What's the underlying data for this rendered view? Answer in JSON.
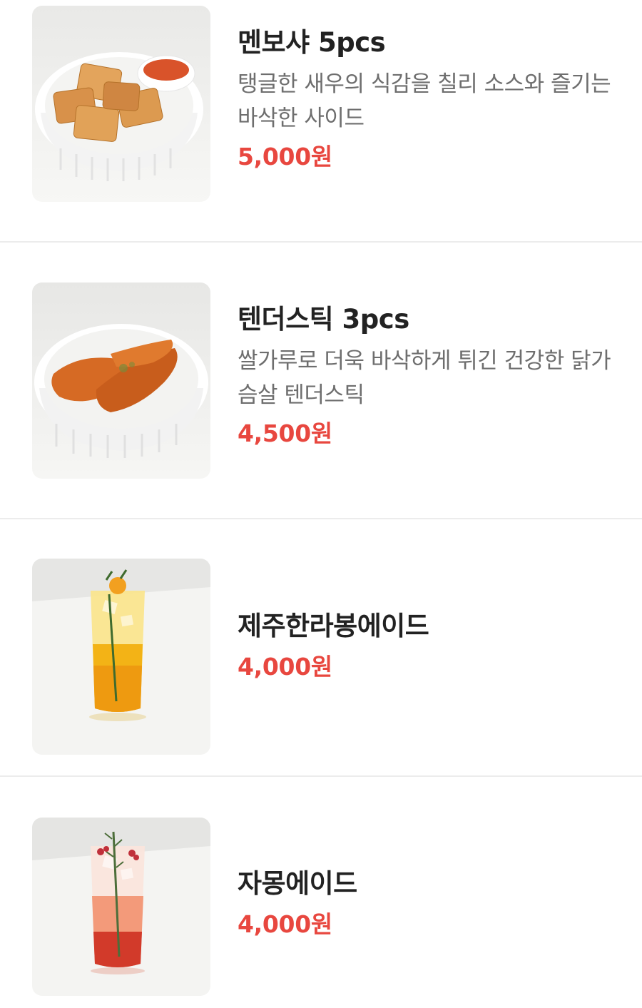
{
  "menu": {
    "items": [
      {
        "name": "멘보샤 5pcs",
        "description": "탱글한 새우의 식감을 칠리 소스와 즐기는 바삭한 사이드",
        "price": "5,000원",
        "image_icon": "menbosha-photo"
      },
      {
        "name": "텐더스틱 3pcs",
        "description": "쌀가루로 더욱 바삭하게 튀긴 건강한 닭가슴살 텐더스틱",
        "price": "4,500원",
        "image_icon": "tender-stick-photo"
      },
      {
        "name": "제주한라봉에이드",
        "description": "",
        "price": "4,000원",
        "image_icon": "hallabong-ade-photo"
      },
      {
        "name": "자몽에이드",
        "description": "",
        "price": "4,000원",
        "image_icon": "grapefruit-ade-photo"
      }
    ]
  },
  "colors": {
    "price": "#e8473f",
    "title": "#222222",
    "description": "#6e6e6e",
    "divider": "#ececec"
  }
}
